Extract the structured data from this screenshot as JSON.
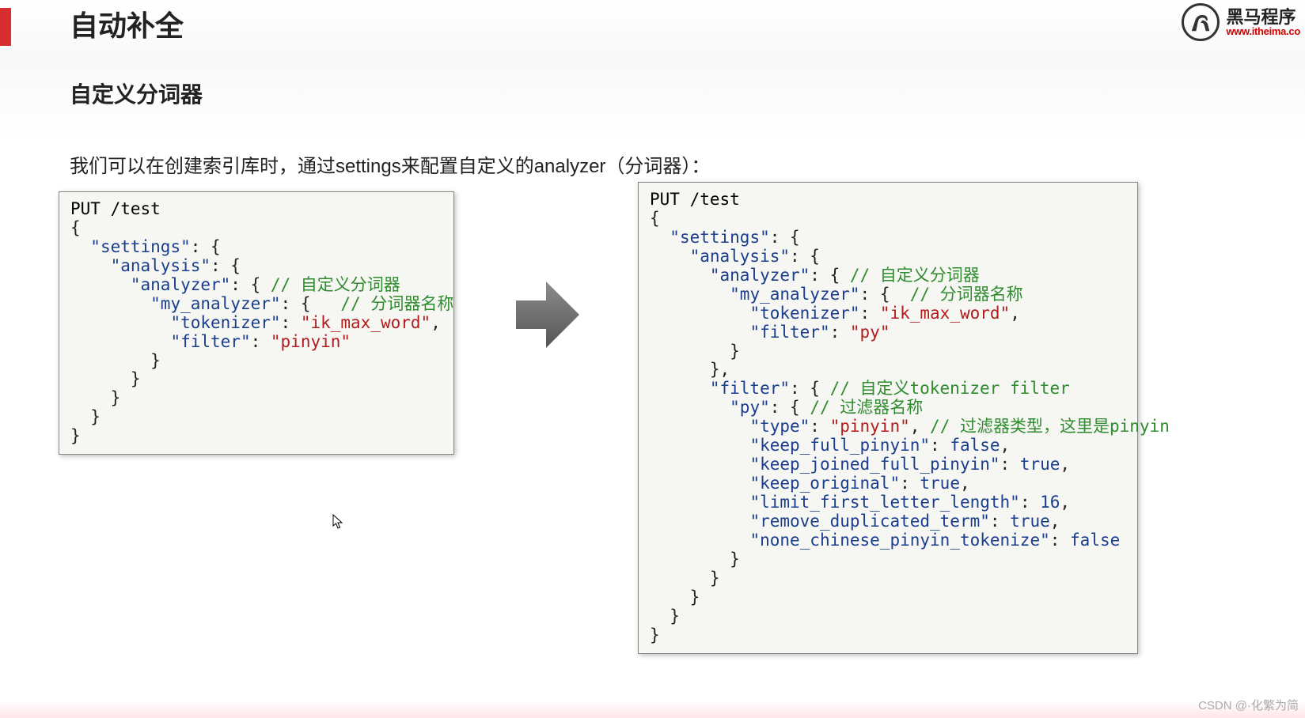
{
  "header": {
    "title": "自动补全",
    "subtitle": "自定义分词器",
    "intro": "我们可以在创建索引库时，通过settings来配置自定义的analyzer（分词器）："
  },
  "logo": {
    "cn": "黑马程序",
    "url": "www.itheima.co"
  },
  "code_left": {
    "request_line": "PUT /test",
    "settings_key": "\"settings\"",
    "analysis_key": "\"analysis\"",
    "analyzer_key": "\"analyzer\"",
    "analyzer_comment": "// 自定义分词器",
    "my_analyzer_key": "\"my_analyzer\"",
    "my_analyzer_comment": "// 分词器名称",
    "tokenizer_key": "\"tokenizer\"",
    "tokenizer_val": "\"ik_max_word\"",
    "filter_key": "\"filter\"",
    "filter_val": "\"pinyin\""
  },
  "code_right": {
    "request_line": "PUT /test",
    "settings_key": "\"settings\"",
    "analysis_key": "\"analysis\"",
    "analyzer_key": "\"analyzer\"",
    "analyzer_comment": "// 自定义分词器",
    "my_analyzer_key": "\"my_analyzer\"",
    "my_analyzer_comment": "// 分词器名称",
    "tokenizer_key": "\"tokenizer\"",
    "tokenizer_val": "\"ik_max_word\"",
    "filter_key": "\"filter\"",
    "filter_val": "\"py\"",
    "filter_def_key": "\"filter\"",
    "filter_def_comment": "// 自定义tokenizer filter",
    "py_key": "\"py\"",
    "py_comment": "// 过滤器名称",
    "type_key": "\"type\"",
    "type_val": "\"pinyin\"",
    "type_comment": "// 过滤器类型，这里是pinyin",
    "kfp_key": "\"keep_full_pinyin\"",
    "kfp_val": "false",
    "kjfp_key": "\"keep_joined_full_pinyin\"",
    "kjfp_val": "true",
    "ko_key": "\"keep_original\"",
    "ko_val": "true",
    "lfll_key": "\"limit_first_letter_length\"",
    "lfll_val": "16",
    "rdt_key": "\"remove_duplicated_term\"",
    "rdt_val": "true",
    "ncpt_key": "\"none_chinese_pinyin_tokenize\"",
    "ncpt_val": "false"
  },
  "watermark": "CSDN @·化繁为简"
}
